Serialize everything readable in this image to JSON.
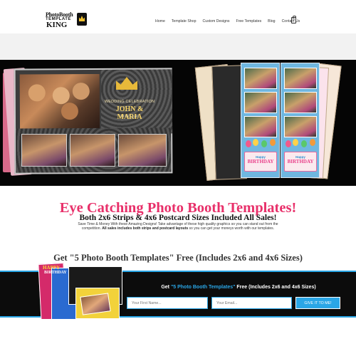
{
  "header": {
    "logo": {
      "line1": "PhotoBooth",
      "line2": "TEMPLATE",
      "line3": "KING"
    },
    "nav": [
      "Home",
      "Template Shop",
      "Custom Designs",
      "Free Templates",
      "Blog",
      "Contact Us"
    ],
    "cart_count": "0"
  },
  "hero": {
    "postcard": {
      "line1": "WEDDING CELEBRATION",
      "line2": "JOHN & MARIA",
      "line3": "24 July 2015"
    },
    "birthday_card": {
      "happy": "Happy",
      "birthday": "BIRTHDAY"
    }
  },
  "main": {
    "headline": "Eye Catching Photo Booth Templates!",
    "subheadline": "Both 2x6 Strips & 4x6 Postcard Sizes Included All Sales!",
    "body_part1": "Save Time & Money With these Amazing Designs! Take advantage of these high quality graphics so you can stand out from the competition.",
    "body_bold": "All sales includes both strips and postcard layouts",
    "body_part2": "so you can get your moneys worth with our templates.",
    "free_title": "Get \"5 Photo Booth Templates\" Free (Includes 2x6 and 4x6 Sizes)"
  },
  "optin": {
    "title_pre": "Get ",
    "title_highlight": "\"5 Photo Booth Templates\"",
    "title_post": " Free (Includes 2x6 and 4x6 Sizes)",
    "first_name_placeholder": "Your First Name...",
    "email_placeholder": "Your Email...",
    "button_label": "GIVE IT TO ME!",
    "promo": {
      "happy": "HAPPY",
      "birthday": "BIRTHDAY"
    }
  },
  "colors": {
    "accent_pink": "#e8306a",
    "accent_blue": "#2aa6e6",
    "dark": "#0c0c0c"
  }
}
